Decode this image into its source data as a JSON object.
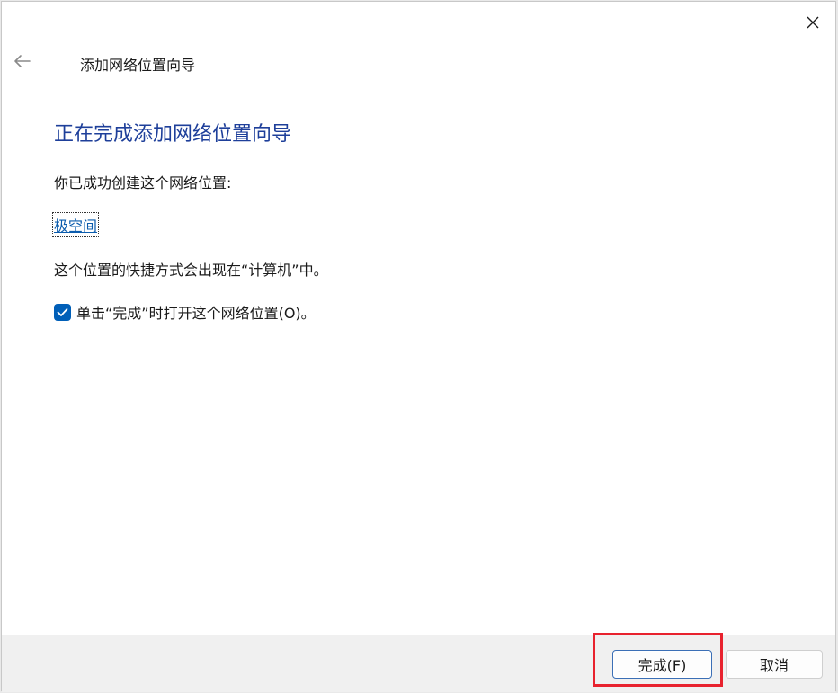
{
  "window": {
    "title": "添加网络位置向导",
    "back_icon": "back-arrow-icon",
    "close_icon": "close-icon"
  },
  "content": {
    "heading": "正在完成添加网络位置向导",
    "success_text": "你已成功创建这个网络位置:",
    "location_name": "极空间",
    "shortcut_text": "这个位置的快捷方式会出现在“计算机”中。",
    "checkbox": {
      "label": "单击“完成”时打开这个网络位置(O)。",
      "checked": true
    }
  },
  "footer": {
    "finish_label": "完成(F)",
    "cancel_label": "取消"
  },
  "colors": {
    "heading": "#1e3f9a",
    "link": "#0b5cad",
    "checkbox": "#005fb8",
    "highlight": "#e8222e"
  }
}
